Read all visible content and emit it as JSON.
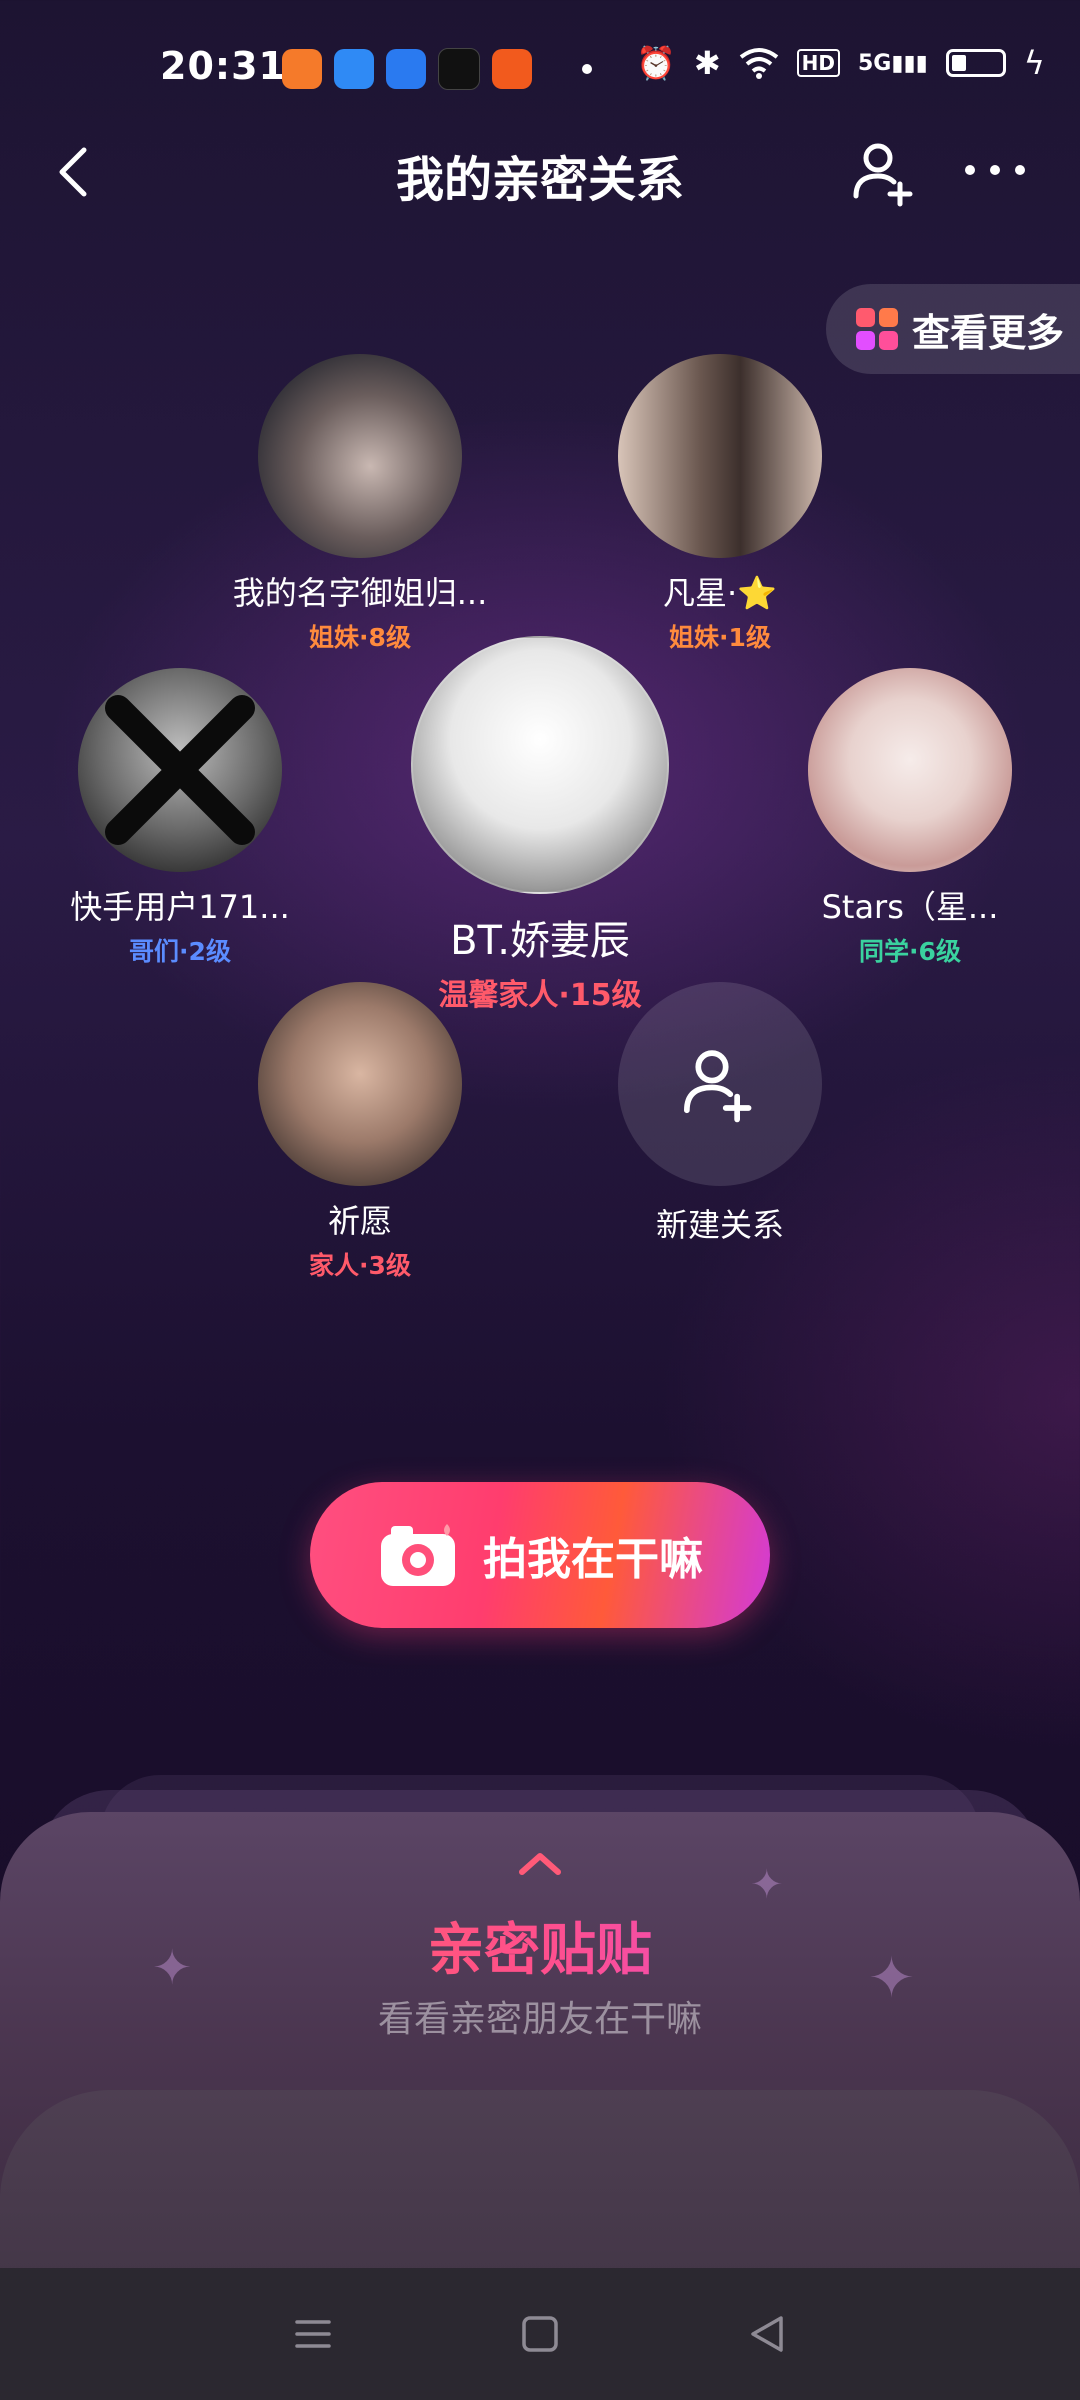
{
  "status_bar": {
    "time": "20:31",
    "app_icons": [
      {
        "name": "kuaishou-icon",
        "color": "#f57a2a"
      },
      {
        "name": "browser-icon",
        "color": "#2f8af5"
      },
      {
        "name": "maps-icon",
        "color": "#2a7af0"
      },
      {
        "name": "tiktok-icon",
        "color": "#111111"
      },
      {
        "name": "weibo-icon",
        "color": "#f25a1d"
      }
    ],
    "network_label": "HD",
    "signal_label": "5G"
  },
  "header": {
    "title": "我的亲密关系"
  },
  "view_more": {
    "label": "查看更多",
    "colors": [
      "#ff5a6e",
      "#ff7a4a",
      "#e24eff",
      "#ff4f9a"
    ]
  },
  "center": {
    "name": "BT.娇妻辰",
    "level": "温馨家人·15级",
    "level_color": "#ff5a6a"
  },
  "relations": [
    {
      "name": "我的名字御姐归...",
      "level": "姐妹·8级",
      "level_color": "#ff8a3d",
      "avatar_tone": [
        "#3a3a45",
        "#c9b8b2"
      ]
    },
    {
      "name": "凡星·⭐",
      "level": "姐妹·1级",
      "level_color": "#ff8a3d",
      "avatar_tone": [
        "#6b5850",
        "#d8c4b8"
      ]
    },
    {
      "name": "快手用户171...",
      "level": "哥们·2级",
      "level_color": "#5b8cff",
      "avatar_tone": [
        "#2a2a2a",
        "#bdbdbd"
      ]
    },
    {
      "name": "Stars（星...",
      "level": "同学·6级",
      "level_color": "#3ad29f",
      "avatar_tone": [
        "#f1e4e0",
        "#c99b98"
      ]
    },
    {
      "name": "祈愿",
      "level": "家人·3级",
      "level_color": "#ff5a6a",
      "avatar_tone": [
        "#5a4a44",
        "#d9b6a2"
      ]
    }
  ],
  "new_relation": {
    "label": "新建关系"
  },
  "camera_button": {
    "label": "拍我在干嘛"
  },
  "sheet": {
    "title": "亲密贴贴",
    "subtitle": "看看亲密朋友在干嘛"
  },
  "nav": {
    "items": [
      "menu-icon",
      "home-icon",
      "back-icon"
    ]
  }
}
